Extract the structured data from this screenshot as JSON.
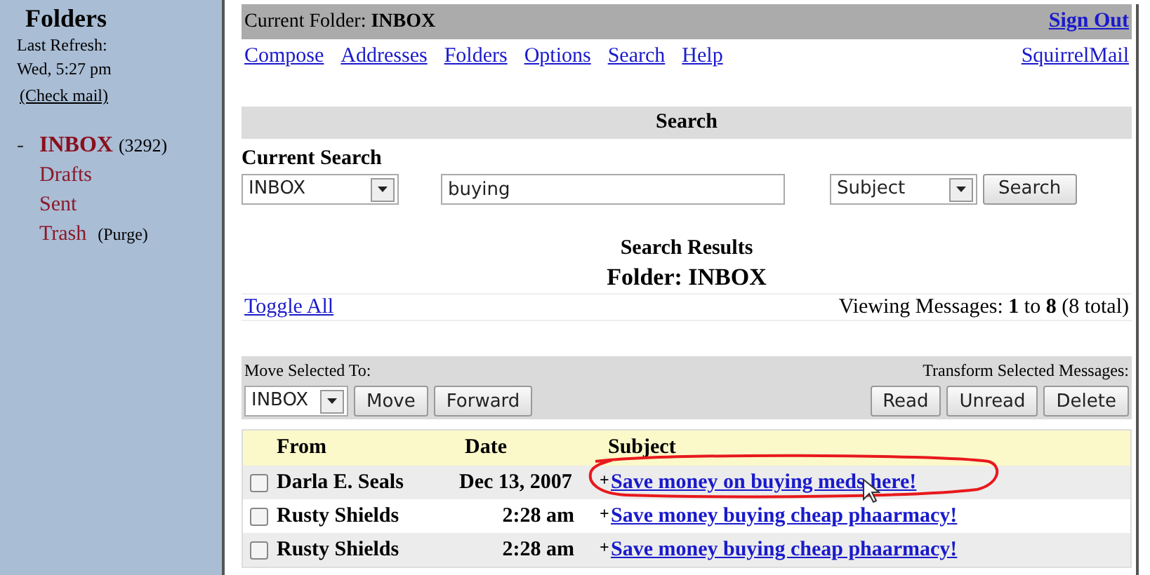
{
  "sidebar": {
    "title": "Folders",
    "refresh_label": "Last Refresh:",
    "refresh_time": "Wed, 5:27 pm",
    "check_mail": "(Check mail)",
    "folders": [
      {
        "marker": "-",
        "name": "INBOX",
        "count": "(3292)",
        "selected": true
      },
      {
        "name": "Drafts",
        "selected": false
      },
      {
        "name": "Sent",
        "selected": false
      },
      {
        "name": "Trash",
        "action": "(Purge)",
        "selected": false
      }
    ]
  },
  "header": {
    "label": "Current Folder:",
    "folder": "INBOX",
    "sign_out": "Sign Out"
  },
  "nav": [
    "Compose",
    "Addresses",
    "Folders",
    "Options",
    "Search",
    "Help"
  ],
  "brand": "SquirrelMail",
  "search": {
    "title": "Search",
    "current_label": "Current Search",
    "folder": "INBOX",
    "query": "buying",
    "field": "Subject",
    "button": "Search"
  },
  "results": {
    "title": "Search Results",
    "folder_label": "Folder: INBOX",
    "toggle": "Toggle All",
    "viewing": "Viewing Messages: **1** to **8** (8 total)"
  },
  "actions": {
    "move_label": "Move Selected To:",
    "move_folder": "INBOX",
    "move_buttons": [
      "Move",
      "Forward"
    ],
    "transform_label": "Transform Selected Messages:",
    "transform_buttons": [
      "Read",
      "Unread",
      "Delete"
    ]
  },
  "table": {
    "columns": [
      "From",
      "Date",
      "Subject"
    ],
    "rows": [
      {
        "from": "Darla E. Seals",
        "date": "Dec 13, 2007",
        "flag": "+",
        "subject": "Save money on buying meds here!",
        "checked": false
      },
      {
        "from": "Rusty Shields",
        "date": "2:28 am",
        "flag": "+",
        "subject": "Save money buying cheap phaarmacy!",
        "checked": false
      },
      {
        "from": "Rusty Shields",
        "date": "2:28 am",
        "flag": "+",
        "subject": "Save money buying cheap phaarmacy!",
        "checked": false
      }
    ]
  }
}
